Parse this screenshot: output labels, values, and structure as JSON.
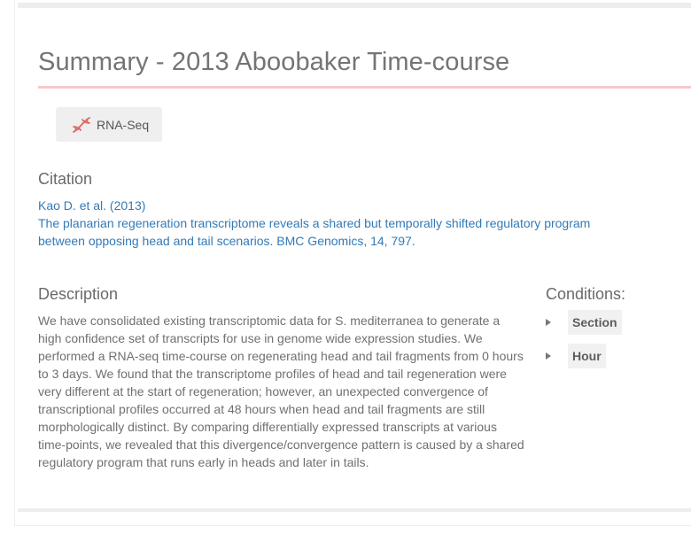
{
  "page_title": "Summary - 2013 Aboobaker Time-course",
  "tag": {
    "label": "RNA-Seq",
    "icon": "dna-icon",
    "icon_color": "#e06666"
  },
  "citation": {
    "heading": "Citation",
    "authors": "Kao D. et al. (2013)",
    "reference": "The planarian regeneration transcriptome reveals a shared but temporally shifted regulatory program between opposing head and tail scenarios. BMC Genomics, 14, 797."
  },
  "description": {
    "heading": "Description",
    "text": "We have consolidated existing transcriptomic data for S. mediterranea to generate a high confidence set of transcripts for use in genome wide expression studies. We performed a RNA-seq time-course on regenerating head and tail fragments from 0 hours to 3 days. We found that the transcriptome profiles of head and tail regeneration were very different at the start of regeneration; however, an unexpected convergence of transcriptional profiles occurred at 48 hours when head and tail fragments are still morphologically distinct. By comparing differentially expressed transcripts at various time-points, we revealed that this divergence/convergence pattern is caused by a shared regulatory program that runs early in heads and later in tails."
  },
  "conditions": {
    "heading": "Conditions:",
    "items": [
      {
        "label": "Section"
      },
      {
        "label": "Hour"
      }
    ]
  },
  "colors": {
    "title_rule": "#f7c9c9",
    "link": "#337ab7",
    "text": "#707070"
  }
}
